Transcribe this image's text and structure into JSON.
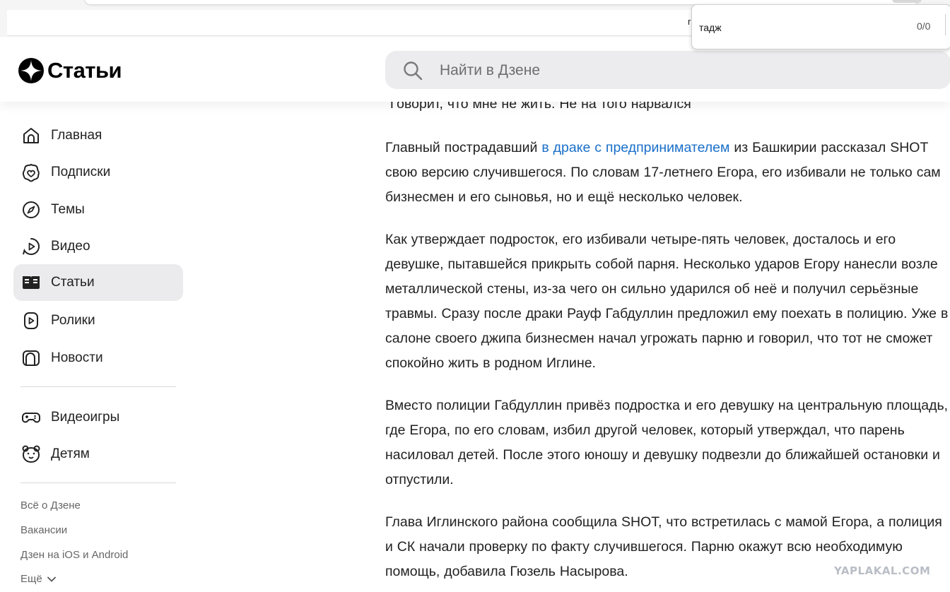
{
  "find_bar": {
    "query": "тадж",
    "count": "0/0"
  },
  "browser_bar": {
    "truncated_letter": "r"
  },
  "header": {
    "logo_text": "Статьи",
    "search_placeholder": "Найти в Дзене"
  },
  "sidebar": {
    "items": [
      {
        "label": "Главная",
        "icon": "home-icon"
      },
      {
        "label": "Подписки",
        "icon": "subscriptions-icon"
      },
      {
        "label": "Темы",
        "icon": "compass-icon"
      },
      {
        "label": "Видео",
        "icon": "video-icon"
      },
      {
        "label": "Статьи",
        "icon": "articles-icon",
        "active": true
      },
      {
        "label": "Ролики",
        "icon": "shorts-icon"
      },
      {
        "label": "Новости",
        "icon": "news-icon"
      }
    ],
    "extra_items": [
      {
        "label": "Видеоигры",
        "icon": "gamepad-icon"
      },
      {
        "label": "Детям",
        "icon": "bear-icon"
      }
    ],
    "footer_links": [
      "Всё о Дзене",
      "Вакансии",
      "Дзен на iOS и Android"
    ],
    "more_label": "Ещё"
  },
  "article": {
    "quote_line": "\"Говорит, что мне не жить. Не на того нарвался\"",
    "p1_before": "Главный пострадавший ",
    "p1_link": "в драке с предпринимателем",
    "p1_after": " из Башкирии рассказал SHOT свою версию случившегося. По словам 17-летнего Егора, его избивали не только сам бизнесмен и его сыновья, но и ещё несколько человек.",
    "p2": "Как утверждает подросток, его избивали четыре-пять человек, досталось и его девушке, пытавшейся прикрыть собой парня. Несколько ударов Егору нанесли возле металлической стены, из-за чего он сильно ударился об неё и получил серьёзные травмы. Сразу после драки Рауф Габдуллин предложил ему поехать в полицию. Уже в салоне своего джипа бизнесмен начал угрожать парню и говорил, что тот не сможет спокойно жить в родном Иглине.",
    "p3": "Вместо полиции Габдуллин привёз подростка и его девушку на центральную площадь, где Егора, по его словам, избил другой человек, который утверждал, что парень насиловал детей. После этого юношу и девушку подвезли до ближайшей остановки и отпустили.",
    "p4": "Глава Иглинского района сообщила SHOT, что встретилась с мамой Егора, а полиция и СК начали проверку по факту случившегося. Парню окажут всю необходимую помощь, добавила Гюзель Насырова."
  },
  "watermark": "YAPLAKAL.COM"
}
